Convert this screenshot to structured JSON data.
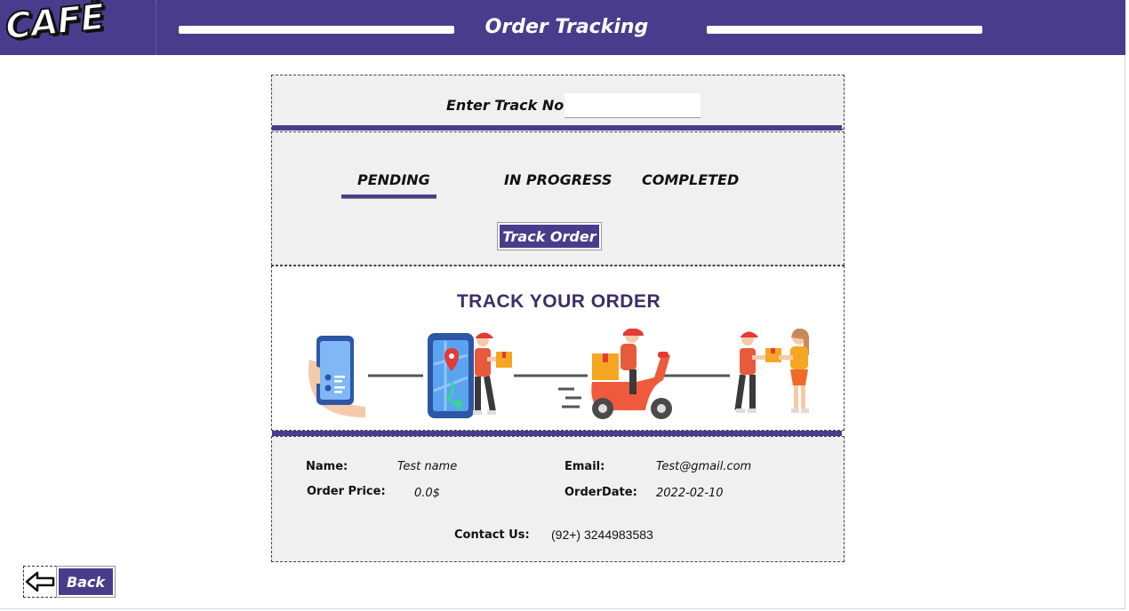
{
  "header": {
    "logo": "CAFÉ",
    "title": "Order Tracking"
  },
  "track": {
    "label": "Enter Track No:",
    "input_value": "",
    "input_placeholder": ""
  },
  "status_tabs": {
    "items": [
      "PENDING",
      "IN PROGRESS",
      "COMPLETED"
    ],
    "selected": "PENDING"
  },
  "track_button": "Track Order",
  "hero": {
    "title": "TRACK YOUR ORDER",
    "icons": [
      "smartphone-icon",
      "map-pin-icon",
      "delivery-man-icon",
      "scooter-icon",
      "handover-icon"
    ]
  },
  "order_info": {
    "name_label": "Name:",
    "name_value": "Test name",
    "email_label": "Email:",
    "email_value": "Test@gmail.com",
    "price_label": "Order Price:",
    "price_value": "0.0$",
    "date_label": "OrderDate:",
    "date_value": "2022-02-10",
    "contact_label": "Contact Us:",
    "contact_value": "(92+) 3244983583"
  },
  "back_button": "Back",
  "colors": {
    "accent": "#4a3c8c",
    "panel_bg": "#f0f0f0",
    "hero_title": "#3d2e66"
  }
}
